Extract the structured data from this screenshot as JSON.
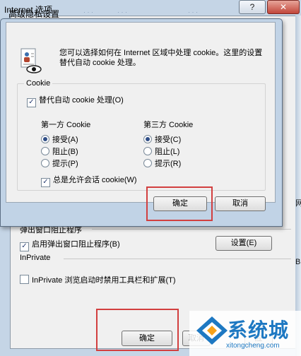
{
  "main_window": {
    "title": "Internet 选项",
    "help_button": "?",
    "close_button": "✕",
    "popup_section": {
      "label": "弹出窗口阻止程序",
      "checkbox_label": "启用弹出窗口阻止程序(B)",
      "checked": true,
      "settings_button": "设置(E)"
    },
    "inprivate_section": {
      "label": "InPrivate",
      "checkbox_label": "InPrivate 浏览启动时禁用工具栏和扩展(T)",
      "checked": false
    },
    "ok_button": "确定",
    "partial_button": "取消",
    "apply_fragment": "应",
    "edge_glyph_a": "网",
    "edge_glyph_b": "B"
  },
  "dialog": {
    "title": "高级隐私设置",
    "intro_text": "您可以选择如何在 Internet 区域中处理 cookie。这里的设置替代自动 cookie 处理。",
    "cookie_group_label": "Cookie",
    "override_label": "替代自动 cookie 处理(O)",
    "override_checked": true,
    "first_party": {
      "heading": "第一方 Cookie",
      "options": [
        "接受(A)",
        "阻止(B)",
        "提示(P)"
      ],
      "selected": "接受(A)"
    },
    "third_party": {
      "heading": "第三方 Cookie",
      "options": [
        "接受(C)",
        "阻止(L)",
        "提示(R)"
      ],
      "selected": "接受(C)"
    },
    "session_label": "总是允许会话 cookie(W)",
    "session_checked": true,
    "ok_button": "确定",
    "cancel_button": "取消"
  },
  "watermark": {
    "brand": "系统城",
    "url": "xitongcheng.com"
  },
  "colors": {
    "highlight_box": "#d23f3f",
    "watermark_blue": "#1d78c2"
  }
}
